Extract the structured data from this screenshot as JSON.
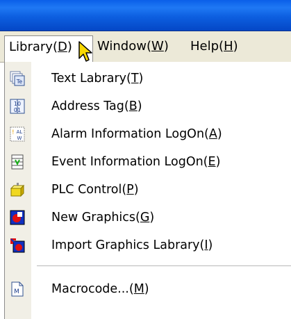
{
  "menubar": {
    "library": {
      "before": "Library(",
      "key": "D",
      "after": ")"
    },
    "window": {
      "before": "Window(",
      "key": "W",
      "after": ")"
    },
    "help": {
      "before": "Help(",
      "key": "H",
      "after": ")"
    }
  },
  "menu": {
    "items": [
      {
        "before": "Text Labrary(",
        "key": "T",
        "after": ")",
        "icon": "text-library-icon"
      },
      {
        "before": "Address Tag(",
        "key": "B",
        "after": ")",
        "icon": "address-tag-icon"
      },
      {
        "before": "Alarm Information LogOn(",
        "key": "A",
        "after": ")",
        "icon": "alarm-info-icon"
      },
      {
        "before": "Event Information LogOn(",
        "key": "E",
        "after": ")",
        "icon": "event-info-icon"
      },
      {
        "before": "PLC Control(",
        "key": "P",
        "after": ")",
        "icon": "plc-control-icon"
      },
      {
        "before": "New Graphics(",
        "key": "G",
        "after": ")",
        "icon": "new-graphics-icon"
      },
      {
        "before": "Import Graphics Labrary(",
        "key": "I",
        "after": ")",
        "icon": "import-graphics-icon"
      },
      {
        "before": "Macrocode...(",
        "key": "M",
        "after": ")",
        "icon": "macrocode-icon"
      }
    ]
  },
  "icons": {
    "text_library": "Te",
    "address_tag_top": "10",
    "address_tag_bottom": "01",
    "alarm_top": "AL",
    "alarm_bottom": "W",
    "macrocode": "M"
  },
  "colors": {
    "titlebar": "#0a5fe8",
    "menubar": "#ece9d8",
    "graphics_red": "#e01010",
    "graphics_blue": "#1030c0"
  }
}
